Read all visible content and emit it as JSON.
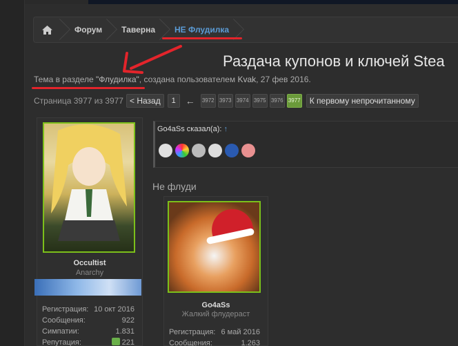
{
  "breadcrumb": {
    "items": [
      "Форум",
      "Таверна",
      "НЕ Флудилка"
    ]
  },
  "thread": {
    "title": "Раздача купонов и ключей Stea",
    "subtitle_prefix": "Тема в разделе ",
    "subtitle_section": "\"Флудилка\"",
    "subtitle_mid": ", создана пользователем ",
    "subtitle_author": "Kvak",
    "subtitle_date": ", 27 фев 2016."
  },
  "pager": {
    "label": "Страница 3977 из 3977",
    "prev": "< Назад",
    "first": "1",
    "arrow": "←",
    "pages": [
      "3972",
      "3973",
      "3974",
      "3975",
      "3976",
      "3977"
    ],
    "active": "3977",
    "first_unread": "К первому непрочитанному"
  },
  "post1": {
    "username": "Occultist",
    "usertitle": "Anarchy",
    "stats": [
      {
        "k": "Регистрация:",
        "v": "10 окт 2016"
      },
      {
        "k": "Сообщения:",
        "v": "922"
      },
      {
        "k": "Симпатии:",
        "v": "1.831"
      },
      {
        "k": "Репутация:",
        "v": "221"
      }
    ]
  },
  "quote": {
    "author": "Go4aSs сказал(а):",
    "up": "↑"
  },
  "message": {
    "text": "Не флуди"
  },
  "post2": {
    "username": "Go4aSs",
    "usertitle": "Жалкий флудераст",
    "stats": [
      {
        "k": "Регистрация:",
        "v": "6 май 2016"
      },
      {
        "k": "Сообщения:",
        "v": "1.263"
      }
    ]
  },
  "colors": {
    "accent_blue": "#5b9bd5",
    "active_page": "#6a9a3a",
    "avatar_border": "#7cc01a",
    "annotation_red": "#e3242b"
  },
  "icons": {
    "home": "home-icon",
    "heart": "heart-icon"
  }
}
